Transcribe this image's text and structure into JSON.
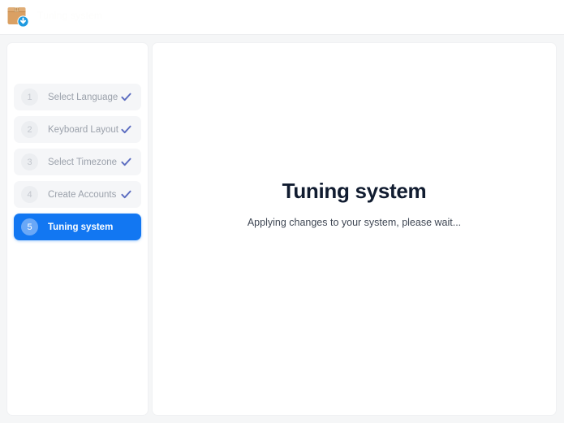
{
  "window": {
    "title": "Tuning system",
    "icon": "package-download-icon"
  },
  "sidebar": {
    "steps": [
      {
        "number": "1",
        "label": "Select Language",
        "state": "done",
        "icon": "check-icon"
      },
      {
        "number": "2",
        "label": "Keyboard Layout",
        "state": "done",
        "icon": "check-icon"
      },
      {
        "number": "3",
        "label": "Select Timezone",
        "state": "done",
        "icon": "check-icon"
      },
      {
        "number": "4",
        "label": "Create Accounts",
        "state": "done",
        "icon": "check-icon"
      },
      {
        "number": "5",
        "label": "Tuning system",
        "state": "active",
        "icon": ""
      }
    ]
  },
  "main": {
    "title": "Tuning system",
    "subtitle": "Applying changes to your system, please wait..."
  },
  "colors": {
    "accent": "#1277f2",
    "check": "#5b6cc0",
    "title_text": "#111c30",
    "muted_text": "#9ba1ab",
    "body_background": "#f5f6f7",
    "panel_background": "#ffffff",
    "step_background": "#f5f6f8"
  }
}
